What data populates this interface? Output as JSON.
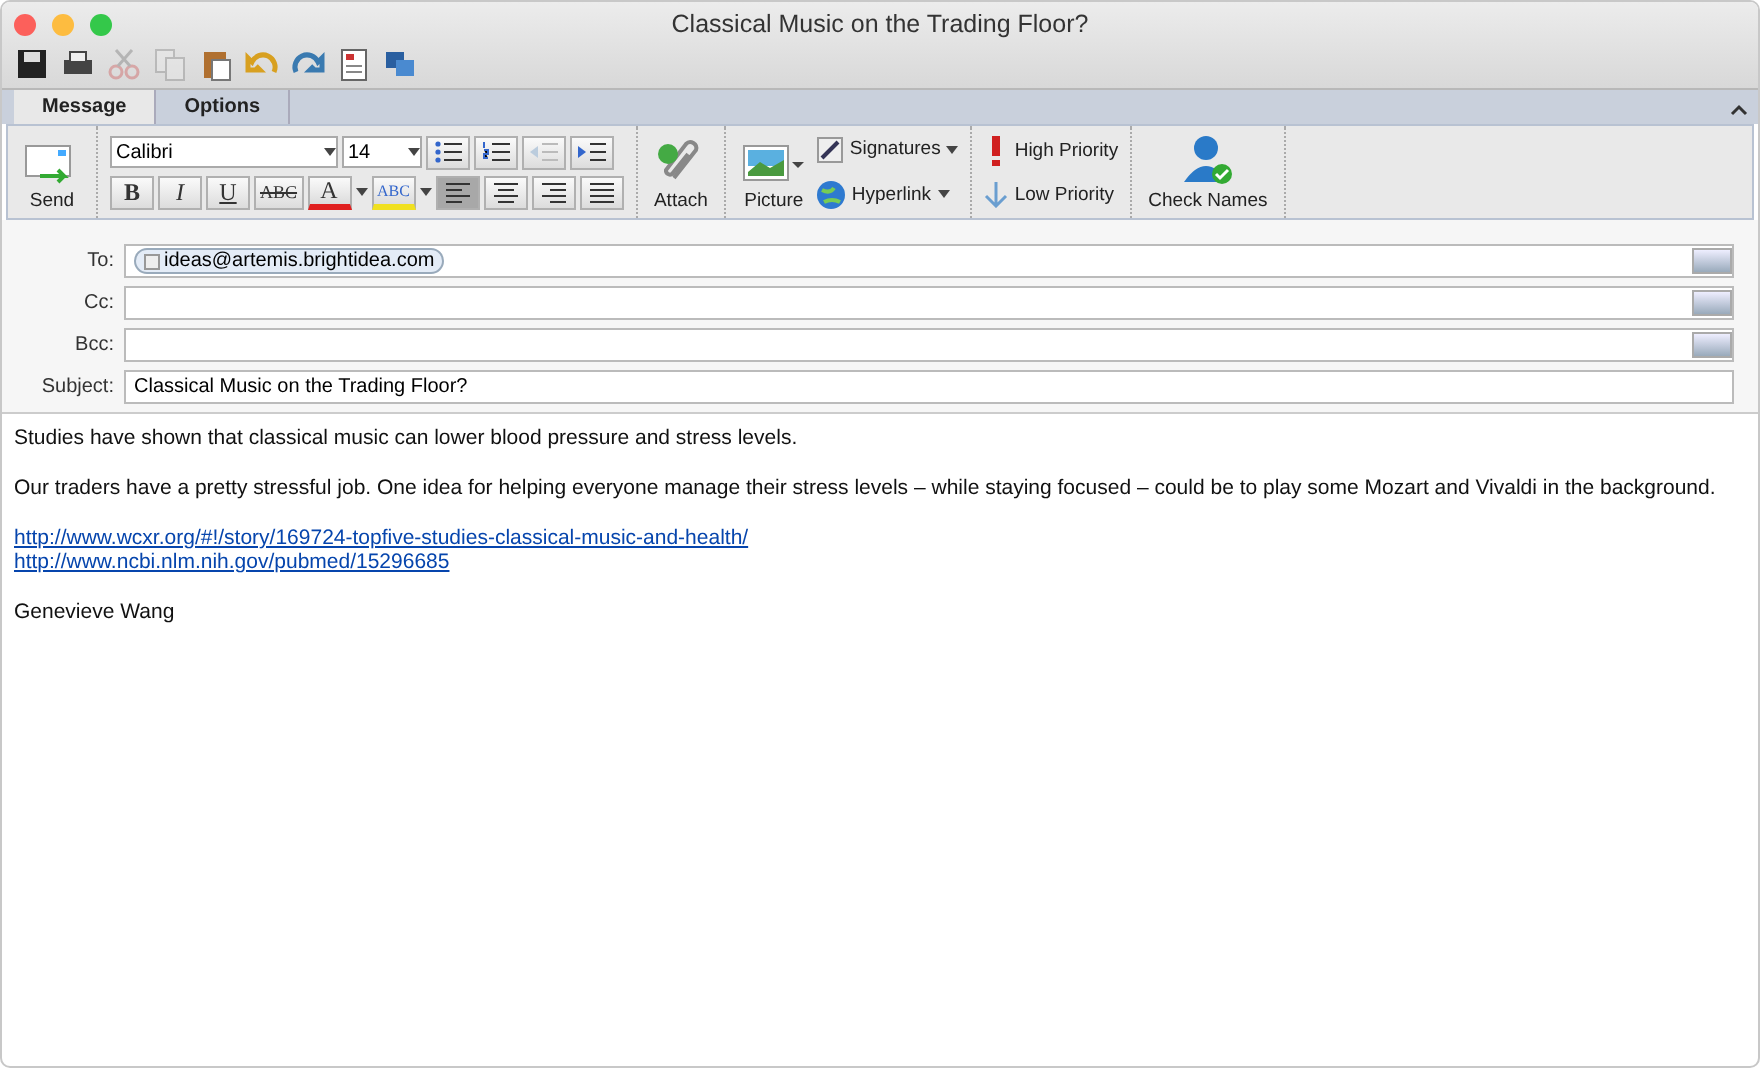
{
  "window": {
    "title": "Classical Music on the Trading Floor?"
  },
  "toolbar": [
    {
      "kind": "save",
      "disabled": false
    },
    {
      "kind": "print",
      "disabled": false
    },
    {
      "kind": "cut",
      "disabled": true
    },
    {
      "kind": "copy",
      "disabled": true
    },
    {
      "kind": "paste",
      "disabled": false
    },
    {
      "kind": "undo",
      "disabled": false
    },
    {
      "kind": "redo",
      "disabled": false
    },
    {
      "kind": "template",
      "disabled": false
    },
    {
      "kind": "media",
      "disabled": false
    }
  ],
  "tabs": [
    {
      "label": "Message",
      "selected": true
    },
    {
      "label": "Options",
      "selected": false
    }
  ],
  "ribbon": {
    "send": "Send",
    "font": "Calibri",
    "size": "14",
    "format_buttons": [
      {
        "kind": "bold",
        "label": "B"
      },
      {
        "kind": "italic",
        "label": "I"
      },
      {
        "kind": "underline",
        "label": "U"
      },
      {
        "kind": "strike",
        "label": "ABC"
      }
    ],
    "font_color": {
      "label": "A",
      "color": "#e02020"
    },
    "highlight": {
      "label": "ABC",
      "color": "#f0e020"
    },
    "align_buttons": [
      {
        "kind": "left",
        "selected": true
      },
      {
        "kind": "center",
        "selected": false
      },
      {
        "kind": "right",
        "selected": false
      },
      {
        "kind": "justify",
        "selected": false
      }
    ],
    "list_buttons": [
      {
        "kind": "bullets",
        "disabled": false
      },
      {
        "kind": "numbers",
        "disabled": false
      },
      {
        "kind": "outdent",
        "disabled": true
      },
      {
        "kind": "indent",
        "disabled": false
      }
    ],
    "attach": "Attach",
    "picture": "Picture",
    "signatures": "Signatures",
    "hyperlink": "Hyperlink",
    "high_priority": "High Priority",
    "low_priority": "Low Priority",
    "check_names": "Check Names"
  },
  "fields": [
    {
      "label": "To:",
      "kind": "address",
      "recipients": [
        "ideas@artemis.brightidea.com"
      ]
    },
    {
      "label": "Cc:",
      "kind": "address"
    },
    {
      "label": "Bcc:",
      "kind": "address"
    },
    {
      "label": "Subject:",
      "kind": "text",
      "value": "Classical Music on the Trading Floor?"
    }
  ],
  "body": [
    {
      "kind": "text",
      "text": "Studies have shown that classical music can lower blood pressure and stress levels."
    },
    {
      "kind": "text",
      "text": "Our traders have a pretty stressful job. One idea for helping everyone manage their stress levels – while staying focused – could be to play some Mozart and Vivaldi in the background."
    },
    {
      "kind": "links",
      "links": [
        "http://www.wcxr.org/#!/story/169724-topfive-studies-classical-music-and-health/",
        "http://www.ncbi.nlm.nih.gov/pubmed/15296685"
      ]
    },
    {
      "kind": "text",
      "text": "Genevieve Wang"
    }
  ]
}
